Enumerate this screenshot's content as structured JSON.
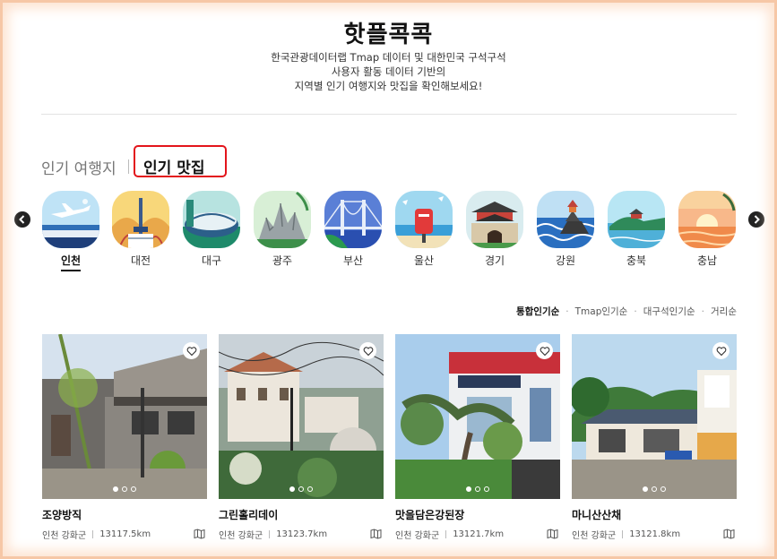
{
  "header": {
    "title": "핫플콕콕",
    "subtitle_lines": [
      "한국관광데이터랩 Tmap 데이터 및 대한민국 구석구석",
      "사용자 활동 데이터 기반의",
      "지역별 인기 여행지와 맛집을 확인해보세요!"
    ]
  },
  "tabs": [
    {
      "label": "인기 여행지",
      "active": false
    },
    {
      "label": "인기 맛집",
      "active": true
    }
  ],
  "regions": [
    {
      "label": "인천",
      "active": true
    },
    {
      "label": "대전",
      "active": false
    },
    {
      "label": "대구",
      "active": false
    },
    {
      "label": "광주",
      "active": false
    },
    {
      "label": "부산",
      "active": false
    },
    {
      "label": "울산",
      "active": false
    },
    {
      "label": "경기",
      "active": false
    },
    {
      "label": "강원",
      "active": false
    },
    {
      "label": "충북",
      "active": false
    },
    {
      "label": "충남",
      "active": false
    }
  ],
  "sort_options": [
    {
      "label": "통합인기순",
      "active": true
    },
    {
      "label": "Tmap인기순",
      "active": false
    },
    {
      "label": "대구석인기순",
      "active": false
    },
    {
      "label": "거리순",
      "active": false
    }
  ],
  "cards": [
    {
      "name": "조양방직",
      "region": "인천 강화군",
      "distance": "13117.5km"
    },
    {
      "name": "그린홀리데이",
      "region": "인천 강화군",
      "distance": "13123.7km"
    },
    {
      "name": "맛을담은강된장",
      "region": "인천 강화군",
      "distance": "13121.7km"
    },
    {
      "name": "마니산산채",
      "region": "인천 강화군",
      "distance": "13121.8km"
    }
  ],
  "icons": {
    "prev": "chevron-left-icon",
    "next": "chevron-right-icon",
    "heart": "heart-icon",
    "map": "map-icon"
  },
  "colors": {
    "highlight": "#e3141b",
    "frame": "#f6c7a6"
  }
}
